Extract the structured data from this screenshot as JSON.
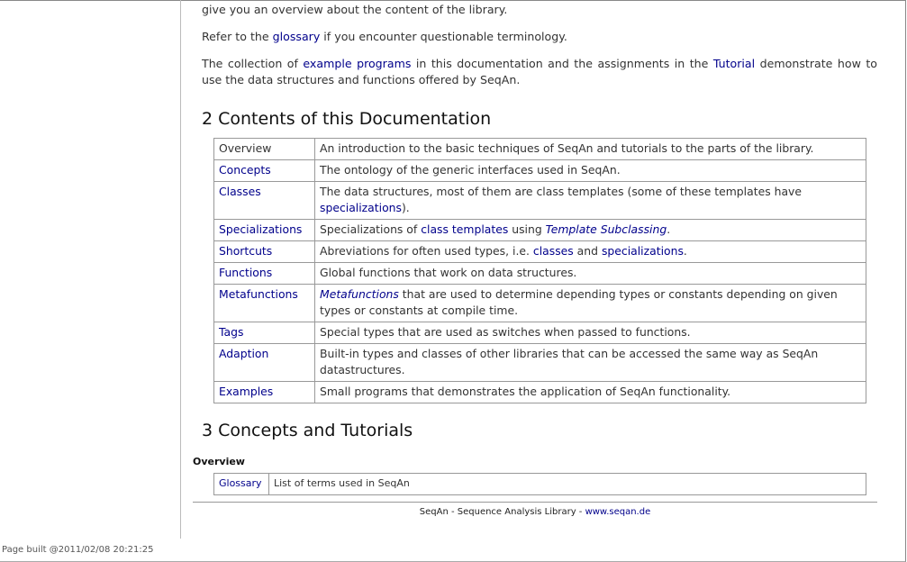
{
  "intro": {
    "line1": "give you an overview about the content of the library.",
    "p2": [
      {
        "text": "Refer to the "
      },
      {
        "text": "glossary",
        "link": true
      },
      {
        "text": " if you encounter questionable terminology."
      }
    ],
    "p3": [
      {
        "text": "The collection of "
      },
      {
        "text": "example programs",
        "link": true
      },
      {
        "text": " in this documentation and the assignments in the "
      },
      {
        "text": "Tutorial",
        "link": true
      },
      {
        "text": " demonstrate how to use the data structures and functions offered by SeqAn."
      }
    ]
  },
  "section2": {
    "title": "2 Contents of this Documentation",
    "rows": [
      {
        "key": "Overview",
        "key_link": false,
        "desc": [
          {
            "text": "An introduction to the basic techniques of SeqAn and tutorials to the parts of the library."
          }
        ]
      },
      {
        "key": "Concepts",
        "key_link": true,
        "desc": [
          {
            "text": "The ontology of the generic interfaces used in SeqAn."
          }
        ]
      },
      {
        "key": "Classes",
        "key_link": true,
        "desc": [
          {
            "text": "The data structures, most of them are class templates (some of these templates have "
          },
          {
            "text": "specializations",
            "link": true
          },
          {
            "text": ")."
          }
        ]
      },
      {
        "key": "Specializations",
        "key_link": true,
        "desc": [
          {
            "text": "Specializations of "
          },
          {
            "text": "class templates",
            "link": true
          },
          {
            "text": " using "
          },
          {
            "text": "Template Subclassing",
            "link": true,
            "italic": true
          },
          {
            "text": "."
          }
        ]
      },
      {
        "key": "Shortcuts",
        "key_link": true,
        "desc": [
          {
            "text": "Abreviations for often used types, i.e. "
          },
          {
            "text": "classes",
            "link": true
          },
          {
            "text": " and "
          },
          {
            "text": "specializations",
            "link": true
          },
          {
            "text": "."
          }
        ]
      },
      {
        "key": "Functions",
        "key_link": true,
        "desc": [
          {
            "text": "Global functions that work on data structures."
          }
        ]
      },
      {
        "key": "Metafunctions",
        "key_link": true,
        "desc": [
          {
            "text": "Metafunctions",
            "link": true,
            "italic": true
          },
          {
            "text": " that are used to determine depending types or constants depending on given types or constants at compile time."
          }
        ]
      },
      {
        "key": "Tags",
        "key_link": true,
        "desc": [
          {
            "text": "Special types that are used as switches when passed to functions."
          }
        ]
      },
      {
        "key": "Adaption",
        "key_link": true,
        "desc": [
          {
            "text": "Built-in types and classes of other libraries that can be accessed the same way as SeqAn datastructures."
          }
        ]
      },
      {
        "key": "Examples",
        "key_link": true,
        "desc": [
          {
            "text": "Small programs that demonstrates the application of SeqAn functionality."
          }
        ]
      }
    ]
  },
  "section3": {
    "title": "3 Concepts and Tutorials",
    "overview_heading": "Overview",
    "rows": [
      {
        "key": "Glossary",
        "desc": "List of terms used in SeqAn"
      }
    ]
  },
  "footer": {
    "text": "SeqAn - Sequence Analysis Library - ",
    "link": "www.seqan.de"
  },
  "build_info": "Page built @2011/02/08 20:21:25",
  "colors": {
    "link": "#00008b",
    "text": "#333333",
    "border": "#999999"
  }
}
